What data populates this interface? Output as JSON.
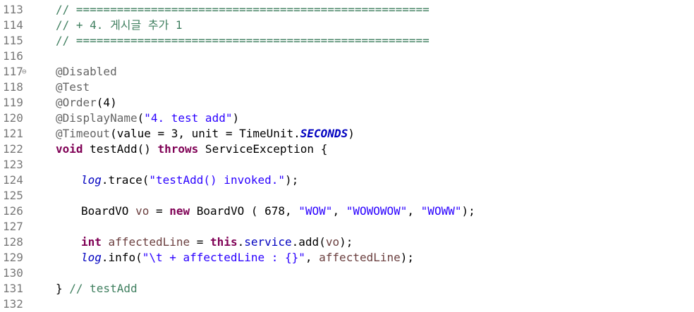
{
  "editor": {
    "lines": [
      {
        "no": "113",
        "fold": "",
        "indent": 0,
        "tokens": [
          {
            "t": "// ====================================================",
            "c": "cm"
          }
        ]
      },
      {
        "no": "114",
        "fold": "",
        "indent": 0,
        "tokens": [
          {
            "t": "// + 4. 게시글 추가 1",
            "c": "cm"
          }
        ]
      },
      {
        "no": "115",
        "fold": "",
        "indent": 0,
        "tokens": [
          {
            "t": "// ====================================================",
            "c": "cm"
          }
        ]
      },
      {
        "no": "116",
        "fold": "",
        "indent": 0,
        "tokens": []
      },
      {
        "no": "117",
        "fold": "⊖",
        "indent": 0,
        "tokens": [
          {
            "t": "@Disabled",
            "c": "an"
          }
        ]
      },
      {
        "no": "118",
        "fold": "",
        "indent": 0,
        "tokens": [
          {
            "t": "@Test",
            "c": "an"
          }
        ]
      },
      {
        "no": "119",
        "fold": "",
        "indent": 0,
        "tokens": [
          {
            "t": "@Order",
            "c": "an"
          },
          {
            "t": "(4)",
            "c": ""
          }
        ]
      },
      {
        "no": "120",
        "fold": "",
        "indent": 0,
        "tokens": [
          {
            "t": "@DisplayName",
            "c": "an"
          },
          {
            "t": "(",
            "c": ""
          },
          {
            "t": "\"4. test add\"",
            "c": "st"
          },
          {
            "t": ")",
            "c": ""
          }
        ]
      },
      {
        "no": "121",
        "fold": "",
        "indent": 0,
        "tokens": [
          {
            "t": "@Timeout",
            "c": "an"
          },
          {
            "t": "(value = 3, unit = TimeUnit.",
            "c": ""
          },
          {
            "t": "SECONDS",
            "c": "sbold"
          },
          {
            "t": ")",
            "c": ""
          }
        ]
      },
      {
        "no": "122",
        "fold": "",
        "indent": 0,
        "tokens": [
          {
            "t": "void",
            "c": "kw"
          },
          {
            "t": " testAdd() ",
            "c": ""
          },
          {
            "t": "throws",
            "c": "kw"
          },
          {
            "t": " ServiceException {",
            "c": ""
          }
        ]
      },
      {
        "no": "123",
        "fold": "",
        "indent": 0,
        "tokens": []
      },
      {
        "no": "124",
        "fold": "",
        "indent": 1,
        "tokens": [
          {
            "t": "log",
            "c": "sfld"
          },
          {
            "t": ".trace(",
            "c": ""
          },
          {
            "t": "\"testAdd() invoked.\"",
            "c": "st"
          },
          {
            "t": ");",
            "c": ""
          }
        ]
      },
      {
        "no": "125",
        "fold": "",
        "indent": 0,
        "tokens": []
      },
      {
        "no": "126",
        "fold": "",
        "indent": 1,
        "tokens": [
          {
            "t": "BoardVO ",
            "c": ""
          },
          {
            "t": "vo",
            "c": "var"
          },
          {
            "t": " = ",
            "c": ""
          },
          {
            "t": "new",
            "c": "kw"
          },
          {
            "t": " BoardVO ( 678, ",
            "c": ""
          },
          {
            "t": "\"WOW\"",
            "c": "st"
          },
          {
            "t": ", ",
            "c": ""
          },
          {
            "t": "\"WOWOWOW\"",
            "c": "st"
          },
          {
            "t": ", ",
            "c": ""
          },
          {
            "t": "\"WOWW\"",
            "c": "st"
          },
          {
            "t": ");",
            "c": ""
          }
        ]
      },
      {
        "no": "127",
        "fold": "",
        "indent": 0,
        "tokens": []
      },
      {
        "no": "128",
        "fold": "",
        "indent": 1,
        "tokens": [
          {
            "t": "int",
            "c": "kw"
          },
          {
            "t": " affectedLine",
            "c": "var"
          },
          {
            "t": " = ",
            "c": ""
          },
          {
            "t": "this",
            "c": "kw"
          },
          {
            "t": ".",
            "c": ""
          },
          {
            "t": "service",
            "c": "fld"
          },
          {
            "t": ".add(",
            "c": ""
          },
          {
            "t": "vo",
            "c": "var"
          },
          {
            "t": ");",
            "c": ""
          }
        ]
      },
      {
        "no": "129",
        "fold": "",
        "indent": 1,
        "tokens": [
          {
            "t": "log",
            "c": "sfld"
          },
          {
            "t": ".info(",
            "c": ""
          },
          {
            "t": "\"\\t + affectedLine : {}\"",
            "c": "st"
          },
          {
            "t": ", ",
            "c": ""
          },
          {
            "t": "affectedLine",
            "c": "var"
          },
          {
            "t": ");",
            "c": ""
          }
        ]
      },
      {
        "no": "130",
        "fold": "",
        "indent": 0,
        "tokens": []
      },
      {
        "no": "131",
        "fold": "",
        "indent": 0,
        "tokens": [
          {
            "t": "} ",
            "c": ""
          },
          {
            "t": "// testAdd",
            "c": "cm"
          }
        ]
      },
      {
        "no": "132",
        "fold": "",
        "indent": 0,
        "tokens": []
      }
    ]
  }
}
